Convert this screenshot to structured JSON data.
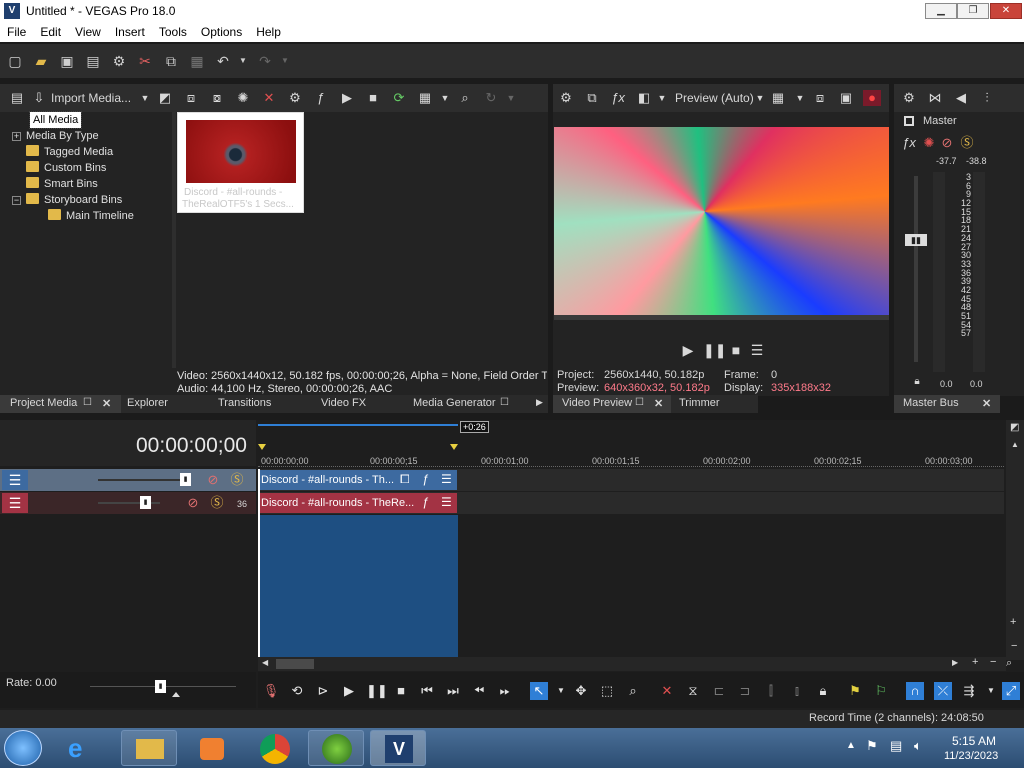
{
  "window": {
    "title": "Untitled * - VEGAS Pro 18.0",
    "logo": "V"
  },
  "menu": [
    "File",
    "Edit",
    "View",
    "Insert",
    "Tools",
    "Options",
    "Help"
  ],
  "media_toolbar": {
    "import_label": "Import Media..."
  },
  "tree": [
    {
      "label": "All Media",
      "selected": true
    },
    {
      "label": "Media By Type",
      "expander": "+"
    },
    {
      "label": "Tagged Media"
    },
    {
      "label": "Custom Bins"
    },
    {
      "label": "Smart Bins"
    },
    {
      "label": "Storyboard Bins",
      "expander": "−"
    },
    {
      "label": "Main Timeline",
      "indent": true
    }
  ],
  "thumbnail": {
    "caption1": "Discord - #all-rounds -",
    "caption2": "TheRealOTF5's 1 Secs..."
  },
  "media_info": {
    "video": "Video: 2560x1440x12, 50.182 fps, 00:00:00;26, Alpha = None, Field Order T",
    "audio": "Audio: 44,100 Hz, Stereo, 00:00:00;26, AAC"
  },
  "left_tabs": [
    "Project Media",
    "Explorer",
    "Transitions",
    "Video FX",
    "Media Generator"
  ],
  "preview": {
    "quality": "Preview (Auto)",
    "project_label": "Project:",
    "project_value": "2560x1440, 50.182p",
    "preview_label": "Preview:",
    "preview_value": "640x360x32, 50.182p",
    "frame_label": "Frame:",
    "frame_value": "0",
    "display_label": "Display:",
    "display_value": "335x188x32",
    "tabs": [
      "Video Preview",
      "Trimmer"
    ]
  },
  "master": {
    "label": "Master",
    "peak_left": "-37.7",
    "peak_right": "-38.8",
    "scale": [
      "3",
      "6",
      "9",
      "12",
      "15",
      "18",
      "21",
      "24",
      "27",
      "30",
      "33",
      "36",
      "39",
      "42",
      "45",
      "48",
      "51",
      "54",
      "57"
    ],
    "fader_left": "0.0",
    "fader_right": "0.0",
    "tab": "Master Bus"
  },
  "timeline": {
    "timecode": "00:00:00;00",
    "duration_badge": "+0:26",
    "ruler": [
      "00:00:00;00",
      "00:00:00;15",
      "00:00:01;00",
      "00:00:01;15",
      "00:00:02;00",
      "00:00:02;15",
      "00:00:03;00"
    ],
    "video_clip": "Discord - #all-rounds - Th...",
    "audio_clip": "Discord - #all-rounds - TheRe...",
    "audio_track_num": "36",
    "rate": "Rate: 0.00"
  },
  "status": {
    "record_time": "Record Time (2 channels): 24:08:50"
  },
  "taskbar": {
    "time": "5:15 AM",
    "date": "11/23/2023"
  },
  "colors": {
    "accent": "#2f7fd6",
    "video_track": "#3d6aa0",
    "audio_track": "#a33344",
    "selection": "#1e4f82"
  }
}
